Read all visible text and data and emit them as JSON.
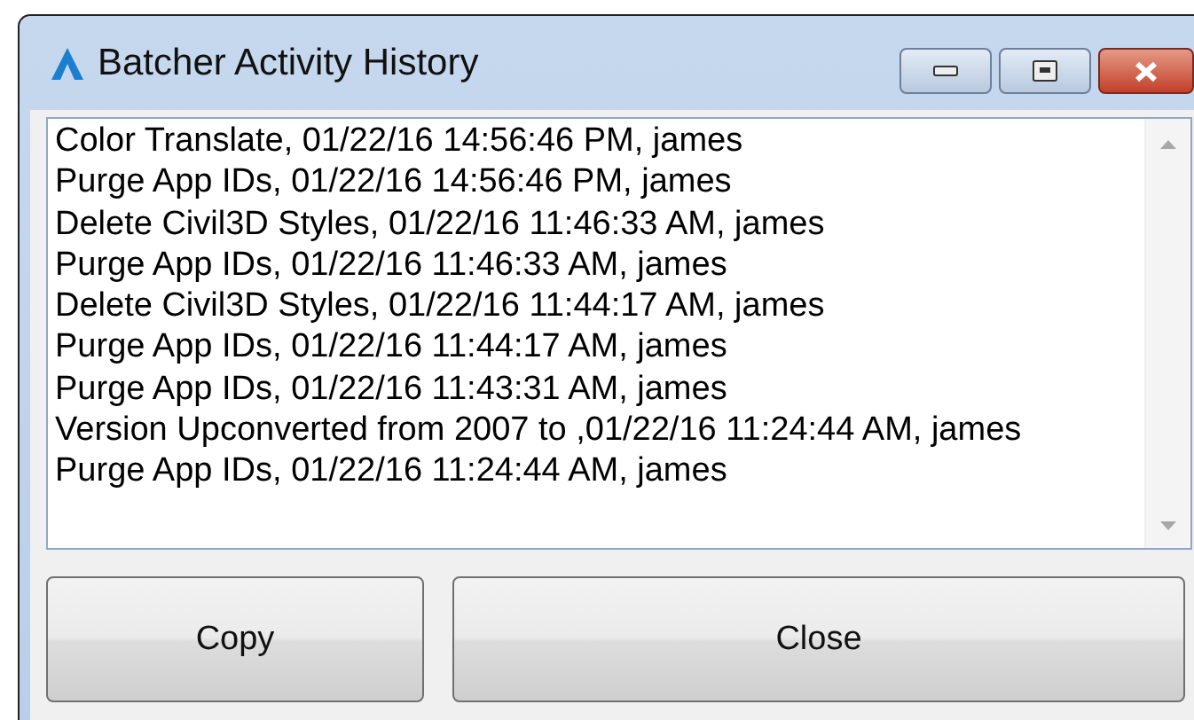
{
  "window": {
    "title": "Batcher Activity History"
  },
  "log_lines": [
    "Color Translate, 01/22/16 14:56:46 PM, james",
    "Purge App IDs, 01/22/16 14:56:46 PM, james",
    "Delete Civil3D Styles, 01/22/16 11:46:33 AM, james",
    "Purge App IDs, 01/22/16 11:46:33 AM, james",
    "Delete Civil3D Styles, 01/22/16 11:44:17 AM, james",
    "Purge App IDs, 01/22/16 11:44:17 AM, james",
    "Purge App IDs, 01/22/16 11:43:31 AM, james",
    "Version Upconverted from 2007 to ,01/22/16 11:24:44 AM, james",
    "Purge App IDs, 01/22/16 11:24:44 AM, james"
  ],
  "buttons": [
    "Copy",
    "Close"
  ]
}
